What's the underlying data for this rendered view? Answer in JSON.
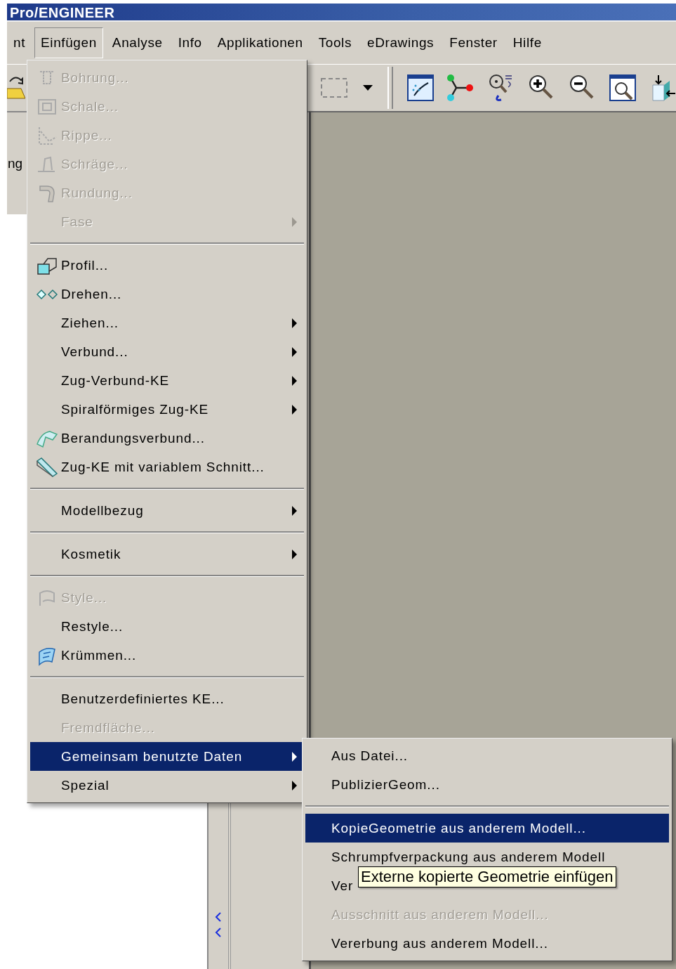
{
  "window": {
    "title": "Pro/ENGINEER"
  },
  "menubar": [
    {
      "label": "nt",
      "selected": false
    },
    {
      "label": "Einfügen",
      "selected": true
    },
    {
      "label": "Analyse",
      "selected": false
    },
    {
      "label": "Info",
      "selected": false
    },
    {
      "label": "Applikationen",
      "selected": false
    },
    {
      "label": "Tools",
      "selected": false
    },
    {
      "label": "eDrawings",
      "selected": false
    },
    {
      "label": "Fenster",
      "selected": false
    },
    {
      "label": "Hilfe",
      "selected": false
    }
  ],
  "side_panel": {
    "label": "ng"
  },
  "insert_menu": {
    "items": [
      {
        "kind": "item",
        "label": "Bohrung...",
        "disabled": true,
        "has_submenu": false,
        "selected": false
      },
      {
        "kind": "item",
        "label": "Schale...",
        "disabled": true,
        "has_submenu": false,
        "selected": false
      },
      {
        "kind": "item",
        "label": "Rippe...",
        "disabled": true,
        "has_submenu": false,
        "selected": false
      },
      {
        "kind": "item",
        "label": "Schräge...",
        "disabled": true,
        "has_submenu": false,
        "selected": false
      },
      {
        "kind": "item",
        "label": "Rundung...",
        "disabled": true,
        "has_submenu": false,
        "selected": false
      },
      {
        "kind": "item",
        "label": "Fase",
        "disabled": true,
        "has_submenu": true,
        "selected": false
      },
      {
        "kind": "separator"
      },
      {
        "kind": "item",
        "label": "Profil...",
        "disabled": false,
        "has_submenu": false,
        "selected": false
      },
      {
        "kind": "item",
        "label": "Drehen...",
        "disabled": false,
        "has_submenu": false,
        "selected": false
      },
      {
        "kind": "item",
        "label": "Ziehen...",
        "disabled": false,
        "has_submenu": true,
        "selected": false
      },
      {
        "kind": "item",
        "label": "Verbund...",
        "disabled": false,
        "has_submenu": true,
        "selected": false
      },
      {
        "kind": "item",
        "label": "Zug-Verbund-KE",
        "disabled": false,
        "has_submenu": true,
        "selected": false
      },
      {
        "kind": "item",
        "label": "Spiralförmiges Zug-KE",
        "disabled": false,
        "has_submenu": true,
        "selected": false
      },
      {
        "kind": "item",
        "label": "Berandungsverbund...",
        "disabled": false,
        "has_submenu": false,
        "selected": false
      },
      {
        "kind": "item",
        "label": "Zug-KE mit variablem Schnitt...",
        "disabled": false,
        "has_submenu": false,
        "selected": false
      },
      {
        "kind": "separator"
      },
      {
        "kind": "item",
        "label": "Modellbezug",
        "disabled": false,
        "has_submenu": true,
        "selected": false
      },
      {
        "kind": "separator"
      },
      {
        "kind": "item",
        "label": "Kosmetik",
        "disabled": false,
        "has_submenu": true,
        "selected": false
      },
      {
        "kind": "separator"
      },
      {
        "kind": "item",
        "label": "Style...",
        "disabled": true,
        "has_submenu": false,
        "selected": false
      },
      {
        "kind": "item",
        "label": "Restyle...",
        "disabled": false,
        "has_submenu": false,
        "selected": false
      },
      {
        "kind": "item",
        "label": "Krümmen...",
        "disabled": false,
        "has_submenu": false,
        "selected": false
      },
      {
        "kind": "separator"
      },
      {
        "kind": "item",
        "label": "Benutzerdefiniertes KE...",
        "disabled": false,
        "has_submenu": false,
        "selected": false
      },
      {
        "kind": "item",
        "label": "Fremdfläche...",
        "disabled": true,
        "has_submenu": false,
        "selected": false
      },
      {
        "kind": "item",
        "label": "Gemeinsam benutzte Daten",
        "disabled": false,
        "has_submenu": true,
        "selected": true
      },
      {
        "kind": "item",
        "label": "Spezial",
        "disabled": false,
        "has_submenu": true,
        "selected": false
      }
    ]
  },
  "shared_data_submenu": {
    "items": [
      {
        "kind": "item",
        "label": "Aus Datei...",
        "disabled": false,
        "selected": false
      },
      {
        "kind": "item",
        "label": "PublizierGeom...",
        "disabled": false,
        "selected": false
      },
      {
        "kind": "separator"
      },
      {
        "kind": "item",
        "label": "KopieGeometrie aus anderem Modell...",
        "disabled": false,
        "selected": true
      },
      {
        "kind": "item",
        "label": "Schrumpfverpackung aus anderem Modell",
        "disabled": false,
        "selected": false
      },
      {
        "kind": "item",
        "label": "Ver",
        "disabled": false,
        "selected": false
      },
      {
        "kind": "item",
        "label": "Ausschnitt aus anderem Modell...",
        "disabled": true,
        "selected": false
      },
      {
        "kind": "item",
        "label": "Vererbung aus anderem Modell...",
        "disabled": false,
        "selected": false
      }
    ]
  },
  "tooltip": {
    "text": "Externe kopierte Geometrie einfügen"
  }
}
